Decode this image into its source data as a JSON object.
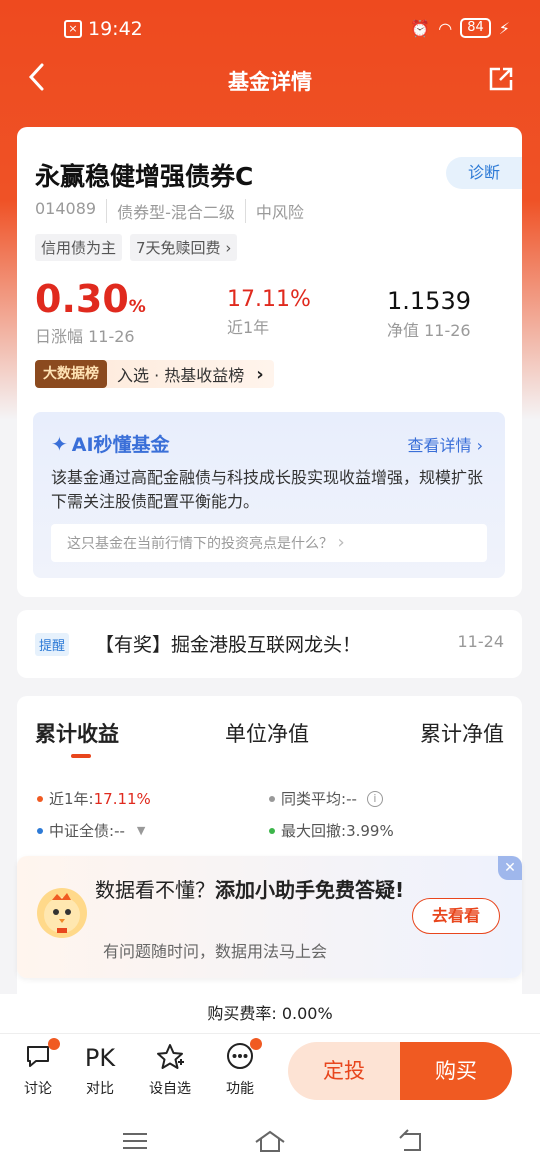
{
  "status_bar": {
    "time": "19:42",
    "battery": "84"
  },
  "nav": {
    "title": "基金详情",
    "back_icon": "chevron-left-icon",
    "share_icon": "share-icon"
  },
  "fund": {
    "name": "永赢稳健增强债券C",
    "diagnose": "诊断",
    "code": "014089",
    "type": "债券型-混合二级",
    "risk": "中风险",
    "tags": [
      "信用债为主",
      "7天免赎回费 ›"
    ],
    "daily_change": "0.30",
    "daily_change_unit": "%",
    "daily_label": "日涨幅  11-26",
    "year_return": "17.11%",
    "year_label": "近1年",
    "nav_value": "1.1539",
    "nav_label": "净值  11-26",
    "rank_badge": "大数据榜",
    "rank_text": "入选 · 热基收益榜",
    "rank_arrow": "›"
  },
  "ai": {
    "title": "AI秒懂基金",
    "more": "查看详情",
    "text": "该基金通过高配金融债与科技成长股实现收益增强，规模扩张下需关注股债配置平衡能力。",
    "question": "这只基金在当前行情下的投资亮点是什么？"
  },
  "notice": {
    "badge": "提醒",
    "text": "【有奖】掘金港股互联网龙头！",
    "date": "11-24"
  },
  "chart": {
    "tabs": [
      "累计收益",
      "单位净值",
      "累计净值"
    ],
    "legend": [
      {
        "label": "近1年:",
        "value": "17.11%",
        "color": "#f05a22"
      },
      {
        "label": "同类平均:",
        "value": "--",
        "color": "#999999"
      },
      {
        "label": "中证全债:",
        "value": "--",
        "color": "#2d7ad6"
      },
      {
        "label": "最大回撤:",
        "value": "3.99%",
        "color": "#3cb54a"
      }
    ]
  },
  "helper": {
    "title_normal": "数据看不懂？",
    "title_bold": "添加小助手免费答疑!",
    "sub": "有问题随时问，数据用法马上会",
    "button": "去看看"
  },
  "fee": {
    "text": "购买费率: 0.00%"
  },
  "bottom_bar": {
    "items": [
      {
        "label": "讨论",
        "icon": "chat-icon"
      },
      {
        "label": "对比",
        "icon": "PK"
      },
      {
        "label": "设自选",
        "icon": "star-plus-icon"
      },
      {
        "label": "功能",
        "icon": "more-icon"
      }
    ],
    "fixed_invest": "定投",
    "buy": "购买"
  }
}
